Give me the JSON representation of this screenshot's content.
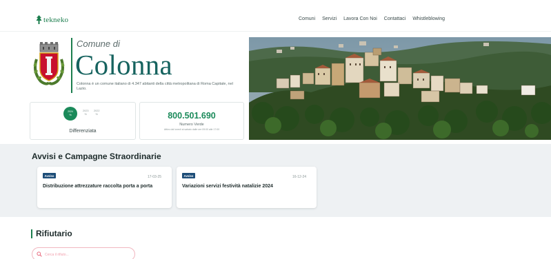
{
  "header": {
    "logo_text": "tekneko",
    "nav": [
      "Comuni",
      "Servizi",
      "Lavora Con Noi",
      "Contattaci",
      "Whistleblowing"
    ]
  },
  "hero": {
    "comune_di": "Comune di",
    "name": "Colonna",
    "description": "Colonna è un comune italiano di 4.347 abitanti della città metropolitana di Roma Capitale, nel Lazio."
  },
  "differenziata": {
    "current_year": "2024",
    "current_value": "%",
    "previous": [
      {
        "year": "2023",
        "value": "%"
      },
      {
        "year": "2022",
        "value": "%"
      }
    ],
    "label": "Differenziata"
  },
  "numero_verde": {
    "number": "800.501.690",
    "label": "Numero Verde",
    "hours": "Attivo dal lunedì al sabato dalle ore 09:00 alle 17:00"
  },
  "avvisi": {
    "title": "Avvisi e Campagne Straordinarie",
    "items": [
      {
        "badge": "Avviso",
        "date": "17-03-25",
        "title": "Distribuzione attrezzature raccolta porta a porta"
      },
      {
        "badge": "Avviso",
        "date": "16-12-24",
        "title": "Variazioni servizi festività natalizie 2024"
      }
    ]
  },
  "rifiutario": {
    "title": "Rifiutario",
    "search_placeholder": "Cerca il rifiuto..."
  },
  "colors": {
    "brand_green": "#1b7d4d",
    "title_teal": "#16635f",
    "badge_blue": "#1d4d78",
    "section_bg": "#eef1f3",
    "search_border": "#f1b6bf"
  }
}
